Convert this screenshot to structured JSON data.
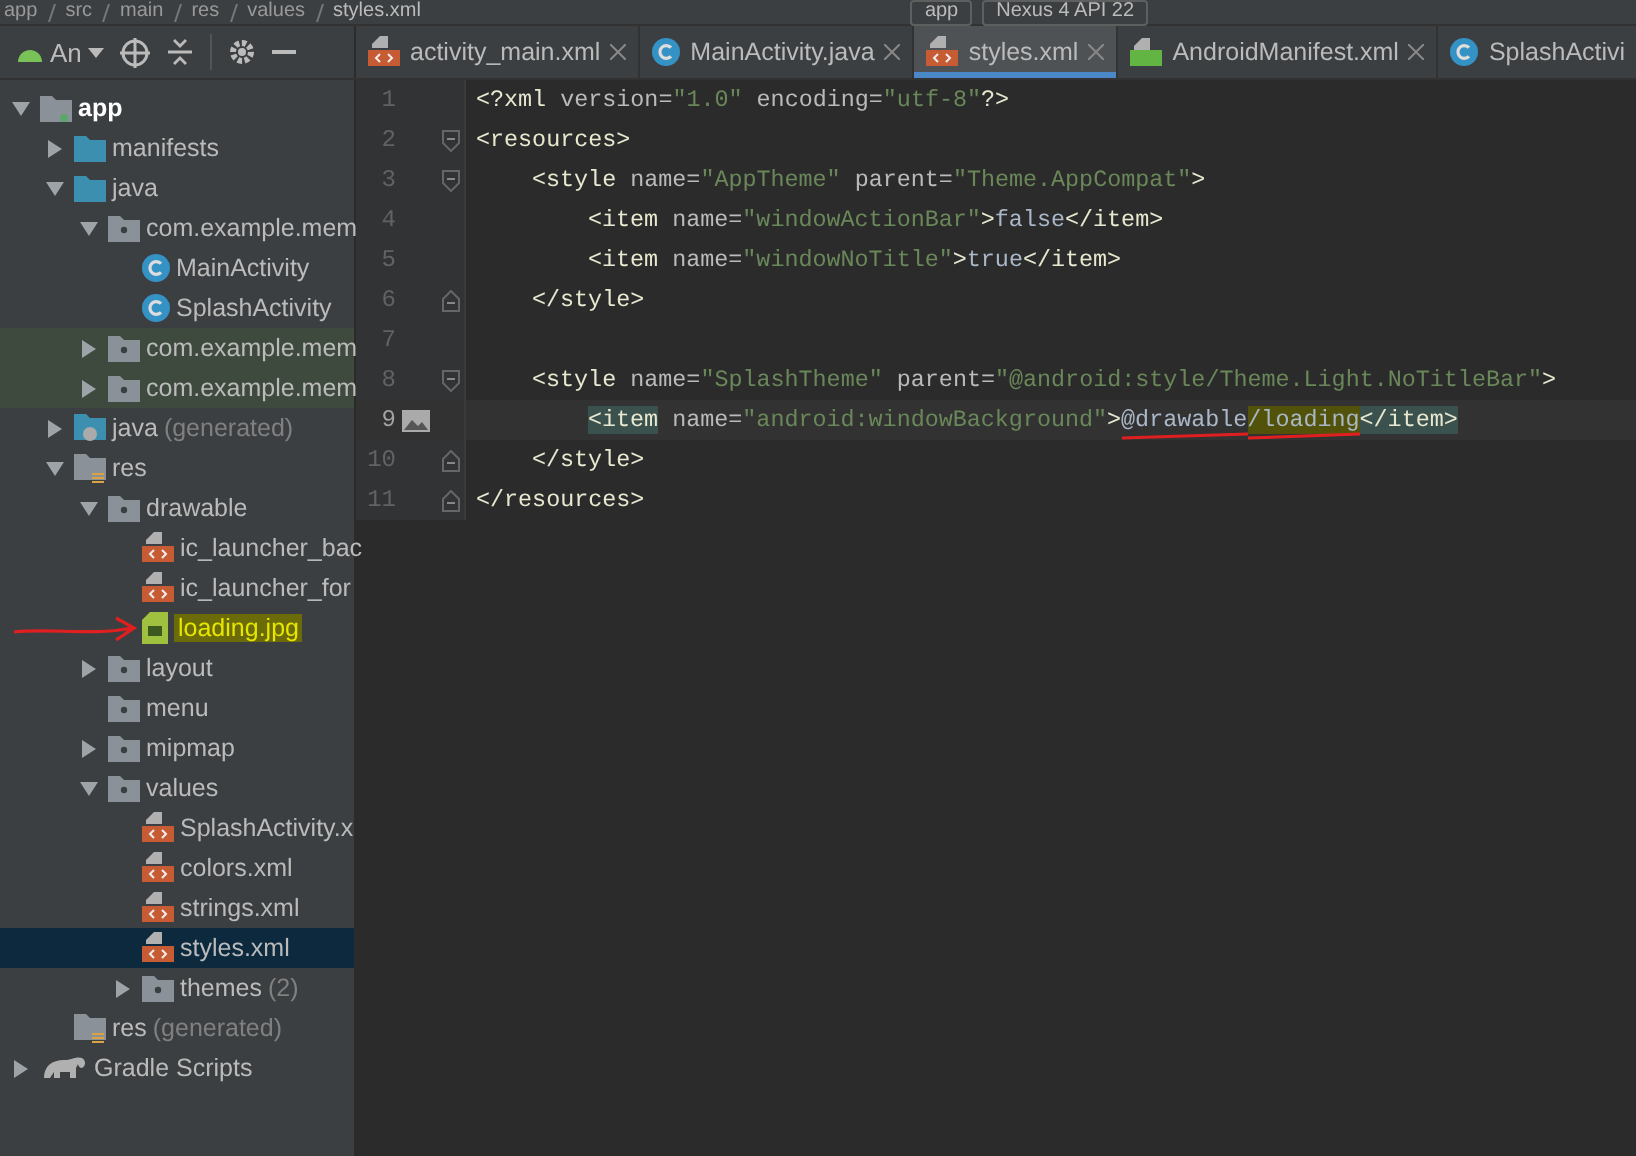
{
  "breadcrumbs": [
    "app",
    "src",
    "main",
    "res",
    "values",
    "styles.xml"
  ],
  "run_config": "app",
  "device": "Nexus 4 API 22",
  "project_view": {
    "label": "An"
  },
  "tabs": [
    {
      "label": "activity_main.xml",
      "kind": "xml",
      "selected": false
    },
    {
      "label": "MainActivity.java",
      "kind": "class",
      "selected": false
    },
    {
      "label": "styles.xml",
      "kind": "xml",
      "selected": true
    },
    {
      "label": "AndroidManifest.xml",
      "kind": "manifest",
      "selected": false
    },
    {
      "label": "SplashActivi",
      "kind": "class",
      "selected": false
    }
  ],
  "tree": [
    {
      "label": "app",
      "kind": "module",
      "expanded": true,
      "children": [
        {
          "label": "manifests",
          "kind": "source-folder",
          "expanded": false
        },
        {
          "label": "java",
          "kind": "source-folder",
          "expanded": true,
          "children": [
            {
              "label": "com.example.mem",
              "kind": "package",
              "expanded": true,
              "children": [
                {
                  "label": "MainActivity",
                  "kind": "class"
                },
                {
                  "label": "SplashActivity",
                  "kind": "class"
                }
              ]
            },
            {
              "label": "com.example.mem",
              "kind": "package",
              "expanded": false,
              "scoped": true
            },
            {
              "label": "com.example.mem",
              "kind": "package",
              "expanded": false,
              "scoped": true
            }
          ]
        },
        {
          "label": "java",
          "note": "(generated)",
          "kind": "generated-folder",
          "expanded": false
        },
        {
          "label": "res",
          "kind": "res-folder",
          "expanded": true,
          "children": [
            {
              "label": "drawable",
              "kind": "package",
              "expanded": true,
              "children": [
                {
                  "label": "ic_launcher_bac",
                  "kind": "xml"
                },
                {
                  "label": "ic_launcher_for",
                  "kind": "xml"
                },
                {
                  "label": "loading.jpg",
                  "kind": "image",
                  "marked": true,
                  "annotated": true
                }
              ]
            },
            {
              "label": "layout",
              "kind": "package",
              "expanded": false
            },
            {
              "label": "menu",
              "kind": "package"
            },
            {
              "label": "mipmap",
              "kind": "package",
              "expanded": false
            },
            {
              "label": "values",
              "kind": "package",
              "expanded": true,
              "children": [
                {
                  "label": "SplashActivity.x",
                  "kind": "xml"
                },
                {
                  "label": "colors.xml",
                  "kind": "xml"
                },
                {
                  "label": "strings.xml",
                  "kind": "xml"
                },
                {
                  "label": "styles.xml",
                  "kind": "xml",
                  "selected": true
                },
                {
                  "label": "themes",
                  "note": "(2)",
                  "kind": "package",
                  "expanded": false
                }
              ]
            }
          ]
        },
        {
          "label": "res",
          "note": "(generated)",
          "kind": "res-folder"
        }
      ]
    },
    {
      "label": "Gradle Scripts",
      "kind": "gradle",
      "expanded": false
    }
  ],
  "code": [
    {
      "number": "1",
      "segments": [
        {
          "kind": "tag",
          "text": "<?xml "
        },
        {
          "kind": "attr",
          "text": "version="
        },
        {
          "kind": "value",
          "text": "\"1.0\""
        },
        {
          "kind": "attr",
          "text": " encoding="
        },
        {
          "kind": "value",
          "text": "\"utf-8\""
        },
        {
          "kind": "tag",
          "text": "?>"
        }
      ]
    },
    {
      "number": "2",
      "fold_open": true,
      "segments": [
        {
          "kind": "tag",
          "text": "<resources>"
        }
      ],
      "children": [
        {
          "number": "3",
          "fold_open": true,
          "segments": [
            {
              "kind": "tag",
              "text": "<style "
            },
            {
              "kind": "attr",
              "text": "name="
            },
            {
              "kind": "value",
              "text": "\"AppTheme\""
            },
            {
              "kind": "attr",
              "text": " parent="
            },
            {
              "kind": "value",
              "text": "\"Theme.AppCompat\""
            },
            {
              "kind": "tag",
              "text": ">"
            }
          ],
          "children": [
            {
              "number": "4",
              "segments": [
                {
                  "kind": "tag",
                  "text": "<item "
                },
                {
                  "kind": "attr",
                  "text": "name="
                },
                {
                  "kind": "value",
                  "text": "\"windowActionBar\""
                },
                {
                  "kind": "tag",
                  "text": ">"
                },
                {
                  "kind": "plain",
                  "text": "false"
                },
                {
                  "kind": "tag",
                  "text": "</item>"
                }
              ]
            },
            {
              "number": "5",
              "segments": [
                {
                  "kind": "tag",
                  "text": "<item "
                },
                {
                  "kind": "attr",
                  "text": "name="
                },
                {
                  "kind": "value",
                  "text": "\"windowNoTitle\""
                },
                {
                  "kind": "tag",
                  "text": ">"
                },
                {
                  "kind": "plain",
                  "text": "true"
                },
                {
                  "kind": "tag",
                  "text": "</item>"
                }
              ]
            }
          ]
        },
        {
          "number": "6",
          "fold_close": true,
          "segments": [
            {
              "kind": "tag",
              "text": "</style>"
            }
          ]
        },
        {
          "number": "7"
        },
        {
          "number": "8",
          "fold_open": true,
          "segments": [
            {
              "kind": "tag",
              "text": "<style "
            },
            {
              "kind": "attr",
              "text": "name="
            },
            {
              "kind": "value",
              "text": "\"SplashTheme\""
            },
            {
              "kind": "attr",
              "text": " parent="
            },
            {
              "kind": "value",
              "text": "\"@android:style/Theme.Light.NoTitleBar\""
            },
            {
              "kind": "tag",
              "text": ">"
            }
          ],
          "children": [
            {
              "number": "9",
              "current": true,
              "has_preview": true,
              "segments": [
                {
                  "kind": "tag",
                  "text": "<item",
                  "matched": true
                },
                {
                  "kind": "attr",
                  "text": " name="
                },
                {
                  "kind": "value",
                  "text": "\"android:windowBackground\""
                },
                {
                  "kind": "tag",
                  "text": ">"
                },
                {
                  "kind": "plain",
                  "text": "@drawable",
                  "underlined": true
                },
                {
                  "kind": "plain",
                  "text": "/loading",
                  "marked": true,
                  "underlined": true
                },
                {
                  "kind": "tag",
                  "text": "</item>",
                  "matched": true
                }
              ]
            }
          ]
        },
        {
          "number": "10",
          "fold_close": true,
          "segments": [
            {
              "kind": "tag",
              "text": "</style>"
            }
          ]
        }
      ]
    },
    {
      "number": "11",
      "fold_close": true,
      "segments": [
        {
          "kind": "tag",
          "text": "</resources>"
        }
      ]
    }
  ]
}
